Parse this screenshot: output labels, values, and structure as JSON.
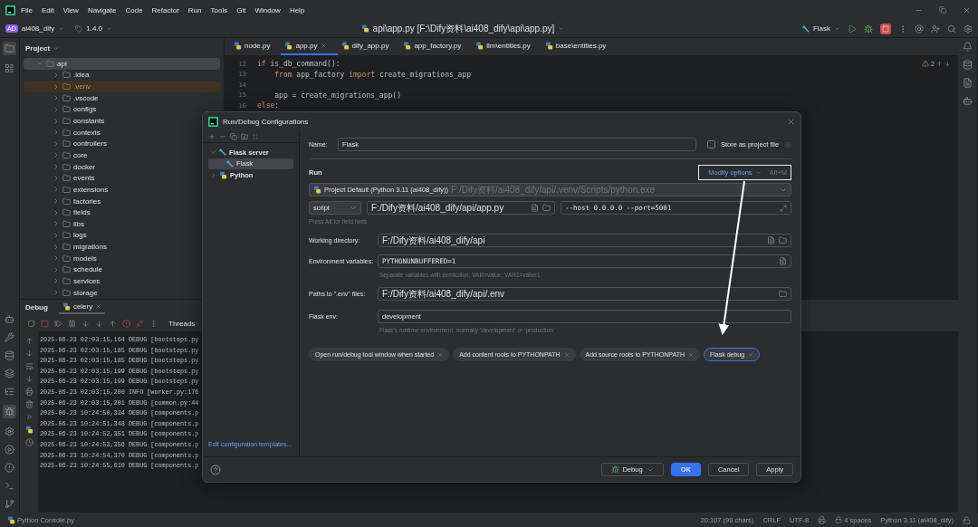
{
  "menu_bar": {
    "items": [
      "File",
      "Edit",
      "View",
      "Navigate",
      "Code",
      "Refactor",
      "Run",
      "Tools",
      "Git",
      "Window",
      "Help"
    ]
  },
  "toolbar": {
    "project_initials": "AD",
    "project_name": "ai408_dify",
    "version": "1.4.0",
    "file_title": "api\\app.py [F:\\Dify资料\\ai408_dify\\api\\app.py]",
    "run_config": "Flask"
  },
  "project_panel": {
    "title": "Project",
    "tree": [
      {
        "label": "api",
        "expanded": true,
        "selected": true,
        "excluded": false,
        "children": [
          {
            "label": ".idea",
            "expanded": false,
            "selected": false,
            "excluded": false
          },
          {
            "label": ".venv",
            "expanded": false,
            "selected": false,
            "excluded": true
          },
          {
            "label": ".vscode",
            "expanded": false,
            "selected": false,
            "excluded": false
          },
          {
            "label": "configs",
            "expanded": false,
            "selected": false,
            "excluded": false
          },
          {
            "label": "constants",
            "expanded": false,
            "selected": false,
            "excluded": false
          },
          {
            "label": "contexts",
            "expanded": false,
            "selected": false,
            "excluded": false
          },
          {
            "label": "controllers",
            "expanded": false,
            "selected": false,
            "excluded": false
          },
          {
            "label": "core",
            "expanded": false,
            "selected": false,
            "excluded": false
          },
          {
            "label": "docker",
            "expanded": false,
            "selected": false,
            "excluded": false
          },
          {
            "label": "events",
            "expanded": false,
            "selected": false,
            "excluded": false
          },
          {
            "label": "extensions",
            "expanded": false,
            "selected": false,
            "excluded": false
          },
          {
            "label": "factories",
            "expanded": false,
            "selected": false,
            "excluded": false
          },
          {
            "label": "fields",
            "expanded": false,
            "selected": false,
            "excluded": false
          },
          {
            "label": "libs",
            "expanded": false,
            "selected": false,
            "excluded": false
          },
          {
            "label": "logs",
            "expanded": false,
            "selected": false,
            "excluded": false
          },
          {
            "label": "migrations",
            "expanded": false,
            "selected": false,
            "excluded": false
          },
          {
            "label": "models",
            "expanded": false,
            "selected": false,
            "excluded": false
          },
          {
            "label": "schedule",
            "expanded": false,
            "selected": false,
            "excluded": false
          },
          {
            "label": "services",
            "expanded": false,
            "selected": false,
            "excluded": false
          },
          {
            "label": "storage",
            "expanded": false,
            "selected": false,
            "excluded": false
          }
        ]
      }
    ]
  },
  "editor": {
    "tabs": [
      {
        "label": "node.py",
        "selected": false
      },
      {
        "label": "app.py",
        "selected": true
      },
      {
        "label": "dify_app.py",
        "selected": false
      },
      {
        "label": "app_factory.py",
        "selected": false
      },
      {
        "label": "llm\\entities.py",
        "selected": false
      },
      {
        "label": "base\\entities.py",
        "selected": false
      }
    ],
    "warnings": "2",
    "lines": [
      {
        "number": "12",
        "tokens": [
          {
            "text": "if",
            "kind": "keyword"
          },
          {
            "text": " is_db_command():",
            "kind": "plain"
          }
        ]
      },
      {
        "number": "13",
        "tokens": [
          {
            "text": "    from",
            "kind": "keyword"
          },
          {
            "text": " app_factory ",
            "kind": "plain"
          },
          {
            "text": "import",
            "kind": "keyword"
          },
          {
            "text": " create_migrations_app",
            "kind": "plain"
          }
        ]
      },
      {
        "number": "14"
      },
      {
        "number": "15",
        "tokens": [
          {
            "text": "    app = create_migrations_app()",
            "kind": "plain"
          }
        ]
      },
      {
        "number": "16",
        "tokens": [
          {
            "text": "else",
            "kind": "keyword"
          },
          {
            "text": ":",
            "kind": "plain"
          }
        ]
      }
    ]
  },
  "debug_panel": {
    "title": "Debug",
    "tab": "celery",
    "threads_label": "Threads",
    "log": [
      "2025-06-23 02:03:15,164 DEBUG [bootsteps.py",
      "2025-06-23 02:03:15,185 DEBUG [bootsteps.py",
      "2025-06-23 02:03:15,185 DEBUG [bootsteps.py",
      "2025-06-23 02:03:15,199 DEBUG [bootsteps.py",
      "2025-06-23 02:03:15,199 DEBUG [bootsteps.py",
      "2025-06-23 02:03:15,200 INFO [worker.py:176",
      "2025-06-23 02:03:15,201 DEBUG [common.py:44",
      "2025-06-23 10:24:50,324 DEBUG [components.p",
      "2025-06-23 10:24:51,348 DEBUG [components.p",
      "2025-06-23 10:24:52,351 DEBUG [components.p",
      "2025-06-23 10:24:53,356 DEBUG [components.p",
      "2025-06-23 10:24:54,370 DEBUG [components.p",
      "2025-06-23 10:24:55,610 DEBUG [components.p"
    ]
  },
  "dialog": {
    "title": "Run/Debug Configurations",
    "tree": [
      {
        "label": "Flask server",
        "kind": "flask",
        "expanded": true,
        "selected": false,
        "children": [
          {
            "label": "Flask",
            "kind": "flask",
            "selected": true
          }
        ]
      },
      {
        "label": "Python",
        "kind": "python",
        "expanded": false,
        "selected": false
      }
    ],
    "templates_link": "Edit configuration templates...",
    "name": {
      "label": "Name:",
      "value": "Flask"
    },
    "store_as_project_file": {
      "label": "Store as project file",
      "checked": false
    },
    "section": "Run",
    "modify_options": {
      "label": "Modify options",
      "shortcut": "Alt+M"
    },
    "interpreter": {
      "value": "Project Default (Python 3.11 (ai408_dify))",
      "path": "F:/Dify资料/ai408_dify/api/.venv/Scripts/python.exe"
    },
    "target_type": "script",
    "script_path": "F:/Dify资料/ai408_dify/api/app.py",
    "parameters": "--host 0.0.0.0 --port=5001",
    "field_hint": "Press Alt for field hints",
    "fields": [
      {
        "label": "Working directory:",
        "value": "F:/Dify资料/ai408_dify/api",
        "kind": "directory"
      },
      {
        "label": "Environment variables:",
        "value": "PYTHONUNBUFFERED=1",
        "kind": "env",
        "hint": "Separate variables with semicolon: VAR=value; VAR1=value1"
      },
      {
        "label": "Paths to \".env\" files:",
        "value": "F:/Dify资料/ai408_dify/api/.env",
        "kind": "file"
      },
      {
        "label": "Flask env:",
        "value": "development",
        "kind": "plain",
        "hint": "Flask's runtime environment: normally 'development' or 'production'"
      }
    ],
    "options": [
      {
        "label": "Open run/debug tool window when started",
        "selected": false
      },
      {
        "label": "Add content roots to PYTHONPATH",
        "selected": false
      },
      {
        "label": "Add source roots to PYTHONPATH",
        "selected": false
      },
      {
        "label": "Flask debug",
        "selected": true
      }
    ],
    "buttons": [
      {
        "label": "Debug",
        "kind": "split"
      },
      {
        "label": "OK",
        "kind": "primary"
      },
      {
        "label": "Cancel",
        "kind": "default"
      },
      {
        "label": "Apply",
        "kind": "default"
      }
    ]
  },
  "status_bar": {
    "file": "Python Console.py",
    "position": "20:107 (99 chars)",
    "line_separator": "CRLF",
    "encoding": "UTF-8",
    "indent": "4 spaces",
    "interpreter": "Python 3.11 (ai408_dify)"
  }
}
